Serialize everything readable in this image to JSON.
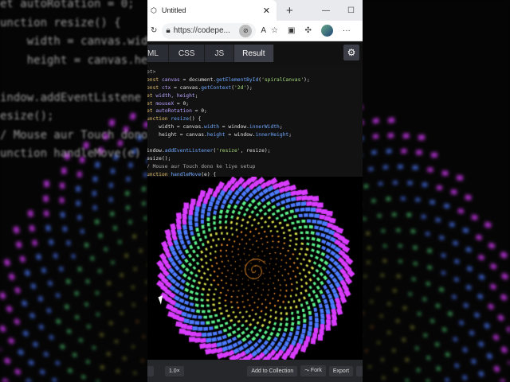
{
  "browser": {
    "tab_title": "Untitled",
    "url": "https://codepe..."
  },
  "codepen": {
    "tabs": [
      "ML",
      "CSS",
      "JS",
      "Result"
    ],
    "active_tab": "Result"
  },
  "code_lines": [
    [
      [
        "pt>",
        "c"
      ]
    ],
    [
      [
        "onst ",
        "k"
      ],
      [
        "canvas",
        "v"
      ],
      [
        " = document.",
        "t"
      ],
      [
        "getElementById",
        "m"
      ],
      [
        "(",
        "t"
      ],
      [
        "'spiralCanvas'",
        "s"
      ],
      [
        ");",
        "t"
      ]
    ],
    [
      [
        "onst ",
        "k"
      ],
      [
        "ctx",
        "v"
      ],
      [
        " = canvas.",
        "t"
      ],
      [
        "getContext",
        "m"
      ],
      [
        "(",
        "t"
      ],
      [
        "'2d'",
        "s"
      ],
      [
        ");",
        "t"
      ]
    ],
    [
      [
        "et ",
        "k"
      ],
      [
        "width, height",
        "v"
      ],
      [
        ";",
        "t"
      ]
    ],
    [
      [
        "et ",
        "k"
      ],
      [
        "mouseX",
        "v"
      ],
      [
        " = 0;",
        "t"
      ]
    ],
    [
      [
        "et ",
        "k"
      ],
      [
        "autoRotation",
        "v"
      ],
      [
        " = 0;",
        "t"
      ]
    ],
    [
      [
        "unction ",
        "k"
      ],
      [
        "resize",
        "m"
      ],
      [
        "() {",
        "t"
      ]
    ],
    [
      [
        "    width = canvas.",
        "t"
      ],
      [
        "width",
        "m"
      ],
      [
        " = window.",
        "t"
      ],
      [
        "innerWidth",
        "m"
      ],
      [
        ";",
        "t"
      ]
    ],
    [
      [
        "    height = canvas.",
        "t"
      ],
      [
        "height",
        "m"
      ],
      [
        " = window.",
        "t"
      ],
      [
        "innerHeight",
        "m"
      ],
      [
        ";",
        "t"
      ]
    ],
    [
      [
        "",
        "t"
      ]
    ],
    [
      [
        "indow.",
        "t"
      ],
      [
        "addEventListener",
        "m"
      ],
      [
        "(",
        "t"
      ],
      [
        "'resize'",
        "s"
      ],
      [
        ", resize);",
        "t"
      ]
    ],
    [
      [
        "esize();",
        "t"
      ]
    ],
    [
      [
        "/ Mouse aur Touch dono ke liye setup",
        "c"
      ]
    ],
    [
      [
        "unction ",
        "k"
      ],
      [
        "handleMove",
        "m"
      ],
      [
        "(e) {",
        "t"
      ]
    ]
  ],
  "bg_code": [
    "et autoRotation = 0;",
    "unction resize() {",
    "    width = canvas.wid",
    "    height = canvas.he",
    "",
    "indow.addEventListene",
    "esize();",
    "/ Mouse aur Touch dono",
    "unction handleMove(e)"
  ],
  "footer": {
    "zoom": "1.0×",
    "add_to_collection": "Add to Collection",
    "fork": "Fork",
    "export": "Export"
  },
  "colors": {
    "inner": "#ff9a2e",
    "mid": "#5cf08a",
    "outer": "#4d7bff",
    "edge": "#d93cff"
  }
}
